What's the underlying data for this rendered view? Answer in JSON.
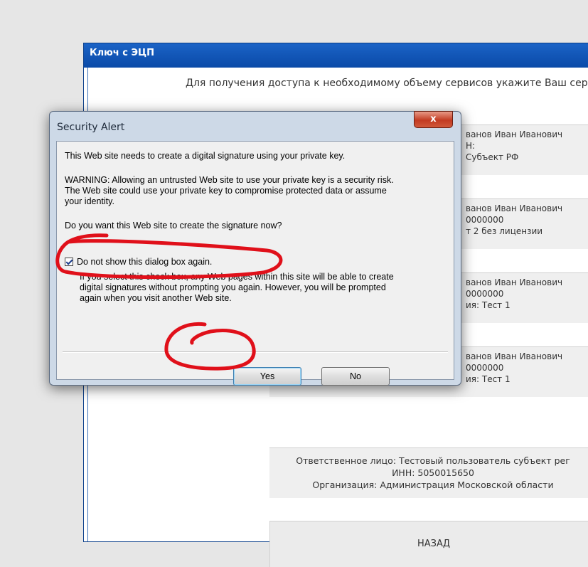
{
  "page": {
    "title": "Ключ с ЭЦП",
    "instruction": "Для получения доступа к необходимому объему сервисов укажите Ваш сер",
    "cert_cards": [
      {
        "lines": [
          "ванов Иван Иванович",
          "Н:",
          "Субъект РФ"
        ]
      },
      {
        "lines": [
          "ванов Иван Иванович",
          "0000000",
          "т 2 без лицензии"
        ]
      },
      {
        "lines": [
          "ванов Иван Иванович",
          "0000000",
          "ия: Тест 1"
        ]
      },
      {
        "lines": [
          "ванов Иван Иванович",
          "0000000",
          "ия: Тест 1"
        ]
      }
    ],
    "responsible": {
      "line1": "Ответственное лицо: Тестовый пользователь субъект рег",
      "line2": "ИНН: 5050015650",
      "line3": "Организация: Администрация Московской области"
    },
    "back_button": "НАЗАД"
  },
  "dialog": {
    "title": "Security Alert",
    "close_label": "x",
    "message": "This Web site needs to create a digital signature using your private key.",
    "warning_lines": [
      "WARNING: Allowing an untrusted Web site to use your private key is a security risk.",
      "The Web site could use your private key to compromise protected data or assume",
      "your identity."
    ],
    "question": "Do you want this Web site to create the signature now?",
    "checkbox_label": "Do not show this dialog box again.",
    "checkbox_checked": true,
    "info_lines": [
      "If you select this check box, any Web pages within this site will be able to create",
      "digital signatures without prompting you again. However, you will be prompted",
      "again when you visit another Web site."
    ],
    "yes_label": "Yes",
    "no_label": "No"
  },
  "colors": {
    "annotation": "#e0101a",
    "titlebar": "#0a4aa8"
  }
}
